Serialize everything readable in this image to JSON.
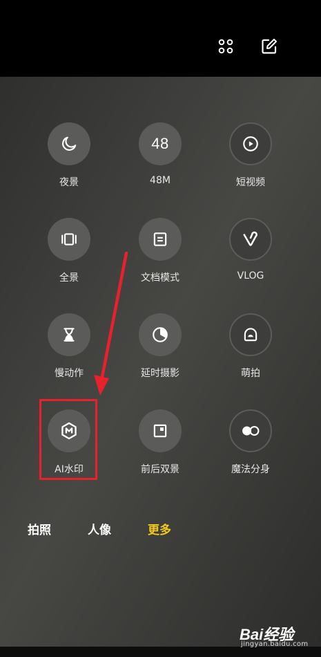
{
  "toolbar": {
    "grid_icon": "grid-icon",
    "edit_icon": "edit-icon"
  },
  "modes": [
    {
      "label": "夜景",
      "icon": "moon-icon"
    },
    {
      "label": "48M",
      "icon": "text-48-icon",
      "text": "48"
    },
    {
      "label": "短视频",
      "icon": "play-icon"
    },
    {
      "label": "全景",
      "icon": "panorama-icon"
    },
    {
      "label": "文档模式",
      "icon": "document-icon"
    },
    {
      "label": "VLOG",
      "icon": "vlog-icon"
    },
    {
      "label": "慢动作",
      "icon": "hourglass-icon"
    },
    {
      "label": "延时摄影",
      "icon": "timelapse-icon"
    },
    {
      "label": "萌拍",
      "icon": "cute-face-icon"
    },
    {
      "label": "AI水印",
      "icon": "ai-watermark-icon"
    },
    {
      "label": "前后双景",
      "icon": "dual-view-icon"
    },
    {
      "label": "魔法分身",
      "icon": "clone-icon"
    }
  ],
  "tabs": [
    {
      "label": "拍照",
      "active": false
    },
    {
      "label": "人像",
      "active": false
    },
    {
      "label": "更多",
      "active": true
    }
  ],
  "colors": {
    "active_tab": "#f5c81c",
    "annotation": "#e8212d"
  },
  "watermark": {
    "logo": "Bai经验",
    "url": "jingyan.baidu.com"
  }
}
